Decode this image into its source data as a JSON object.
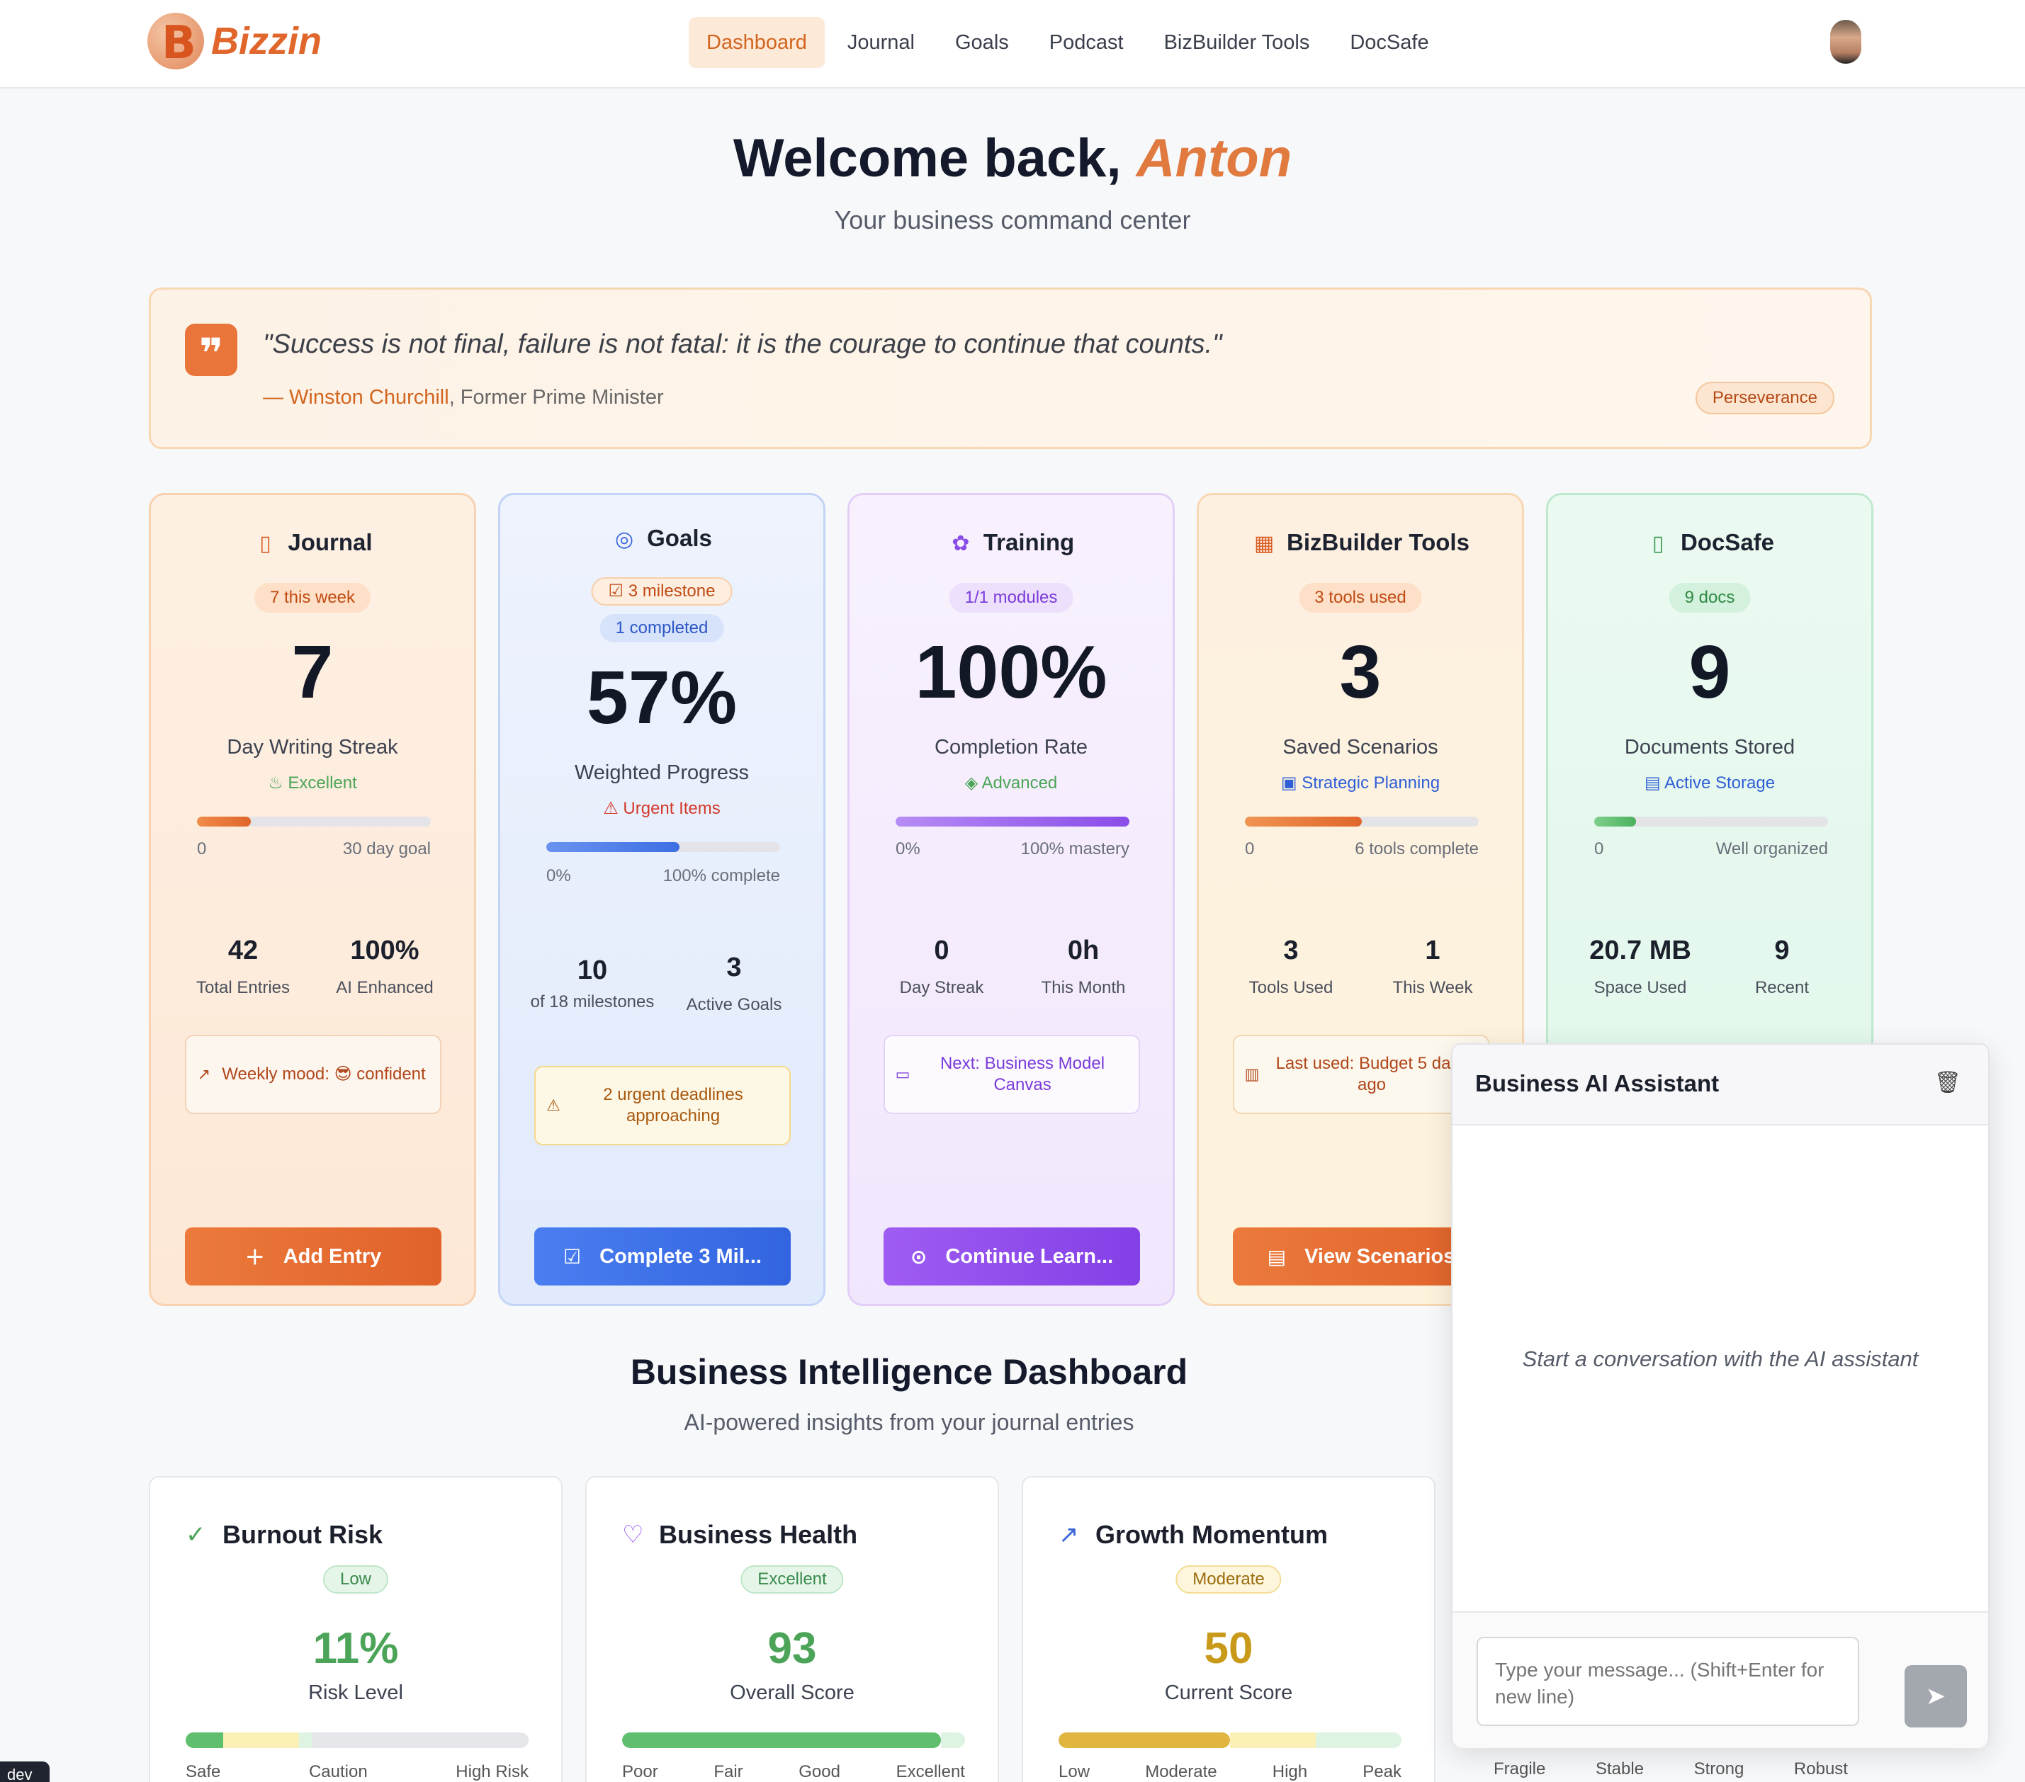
{
  "brand": {
    "logo_letter": "B",
    "name": "Bizzin"
  },
  "nav": [
    {
      "label": "Dashboard",
      "active": true
    },
    {
      "label": "Journal"
    },
    {
      "label": "Goals"
    },
    {
      "label": "Podcast"
    },
    {
      "label": "BizBuilder Tools"
    },
    {
      "label": "DocSafe"
    }
  ],
  "hero": {
    "greeting": "Welcome back, ",
    "name": "Anton",
    "subtitle": "Your business command center"
  },
  "quote": {
    "text": "\"Success is not final, failure is not fatal: it is the courage to continue that counts.\"",
    "author": "— Winston Churchill",
    "role": ", Former Prime Minister",
    "tag": "Perseverance"
  },
  "cards": {
    "journal": {
      "title": "Journal",
      "pill": "7 this week",
      "big": "7",
      "label": "Day Writing Streak",
      "status": "Excellent",
      "progress": 0.23,
      "bar_left": "0",
      "bar_right": "30 day goal",
      "stat1_val": "42",
      "stat1_lbl": "Total Entries",
      "stat2_val": "100%",
      "stat2_lbl": "AI Enhanced",
      "note": "Weekly mood: 😎 confident",
      "button": "Add Entry"
    },
    "goals": {
      "title": "Goals",
      "pill1": "3 milestone",
      "pill2": "1 completed",
      "big": "57%",
      "label": "Weighted Progress",
      "status": "Urgent Items",
      "progress": 0.57,
      "bar_left": "0%",
      "bar_right": "100% complete",
      "stat1_val": "10",
      "stat1_lbl": "of 18 milestones",
      "stat2_val": "3",
      "stat2_lbl": "Active Goals",
      "note": "2 urgent deadlines approaching",
      "button": "Complete 3 Mil..."
    },
    "training": {
      "title": "Training",
      "pill": "1/1 modules",
      "big": "100%",
      "label": "Completion Rate",
      "status": "Advanced",
      "progress": 1.0,
      "bar_left": "0%",
      "bar_right": "100% mastery",
      "stat1_val": "0",
      "stat1_lbl": "Day Streak",
      "stat2_val": "0h",
      "stat2_lbl": "This Month",
      "note": "Next: Business Model Canvas",
      "button": "Continue Learn..."
    },
    "tools": {
      "title": "BizBuilder Tools",
      "pill": "3 tools used",
      "big": "3",
      "label": "Saved Scenarios",
      "status": "Strategic Planning",
      "progress": 0.5,
      "bar_left": "0",
      "bar_right": "6 tools complete",
      "stat1_val": "3",
      "stat1_lbl": "Tools Used",
      "stat2_val": "1",
      "stat2_lbl": "This Week",
      "note": "Last used: Budget 5 days ago",
      "button": "View Scenarios"
    },
    "docs": {
      "title": "DocSafe",
      "pill": "9 docs",
      "big": "9",
      "label": "Documents Stored",
      "status": "Active Storage",
      "progress": 0.18,
      "bar_left": "0",
      "bar_right": "Well organized",
      "stat1_val": "20.7 MB",
      "stat1_lbl": "Space Used",
      "stat2_val": "9",
      "stat2_lbl": "Recent"
    }
  },
  "bi": {
    "title": "Business Intelligence Dashboard",
    "subtitle": "AI-powered insights from your journal entries",
    "cards": [
      {
        "title": "Burnout Risk",
        "badge": "Low",
        "value": "11%",
        "label": "Risk Level",
        "ends": [
          "Safe",
          "Caution",
          "High Risk"
        ]
      },
      {
        "title": "Business Health",
        "badge": "Excellent",
        "value": "93",
        "label": "Overall Score",
        "ends": [
          "Poor",
          "Fair",
          "Good",
          "Excellent"
        ]
      },
      {
        "title": "Growth Momentum",
        "badge": "Moderate",
        "value": "50",
        "label": "Current Score",
        "ends": [
          "Low",
          "Moderate",
          "High",
          "Peak"
        ]
      }
    ],
    "hidden_card_ends": [
      "Fragile",
      "Stable",
      "Strong",
      "Robust"
    ]
  },
  "chat": {
    "title": "Business AI Assistant",
    "empty": "Start a conversation with the AI assistant",
    "placeholder": "Type your message... (Shift+Enter for new line)"
  },
  "dev_badge": "dev",
  "colors": {
    "accent": "#e0662b",
    "blue": "#4274e8",
    "purple": "#9a5cf0",
    "green": "#5fbf6f"
  }
}
